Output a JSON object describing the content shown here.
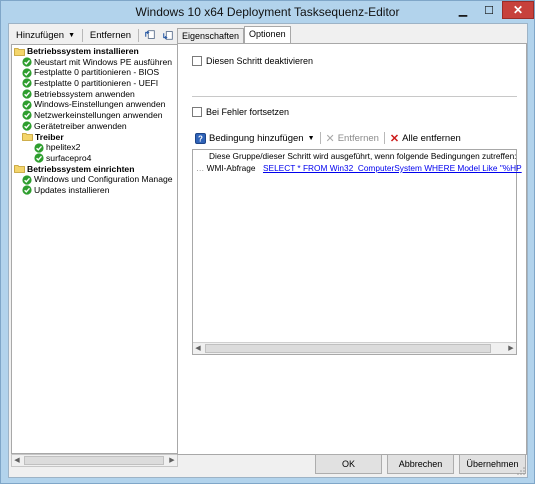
{
  "window": {
    "title": "Windows 10 x64 Deployment Tasksequenz-Editor",
    "minimize_glyph": "▁",
    "maximize_glyph": "☐",
    "close_glyph": "✕"
  },
  "toolbar": {
    "add_label": "Hinzufügen",
    "remove_label": "Entfernen"
  },
  "tree": {
    "items": [
      {
        "label": "Betriebssystem installieren",
        "level": 0,
        "bold": true,
        "icon": "folder-icon"
      },
      {
        "label": "Neustart mit Windows PE ausführen",
        "level": 1,
        "bold": false,
        "icon": "check-icon"
      },
      {
        "label": "Festplatte 0 partitionieren - BIOS",
        "level": 1,
        "bold": false,
        "icon": "check-icon"
      },
      {
        "label": "Festplatte 0 partitionieren - UEFI",
        "level": 1,
        "bold": false,
        "icon": "check-icon"
      },
      {
        "label": "Betriebssystem anwenden",
        "level": 1,
        "bold": false,
        "icon": "check-icon"
      },
      {
        "label": "Windows-Einstellungen anwenden",
        "level": 1,
        "bold": false,
        "icon": "check-icon"
      },
      {
        "label": "Netzwerkeinstellungen anwenden",
        "level": 1,
        "bold": false,
        "icon": "check-icon"
      },
      {
        "label": "Gerätetreiber anwenden",
        "level": 1,
        "bold": false,
        "icon": "check-icon"
      },
      {
        "label": "Treiber",
        "level": 1,
        "bold": true,
        "icon": "folder-icon"
      },
      {
        "label": "hpelitex2",
        "level": 2,
        "bold": false,
        "icon": "check-icon"
      },
      {
        "label": "surfacepro4",
        "level": 2,
        "bold": false,
        "icon": "check-icon"
      },
      {
        "label": "Betriebssystem einrichten",
        "level": 0,
        "bold": true,
        "icon": "folder-icon"
      },
      {
        "label": "Windows und Configuration Manage",
        "level": 1,
        "bold": false,
        "icon": "check-icon"
      },
      {
        "label": "Updates installieren",
        "level": 1,
        "bold": false,
        "icon": "check-icon"
      }
    ]
  },
  "tabs": [
    {
      "label": "Eigenschaften",
      "active": false
    },
    {
      "label": "Optionen",
      "active": true
    }
  ],
  "options": {
    "disable_step_label": "Diesen Schritt deaktivieren",
    "continue_on_error_label": "Bei Fehler fortsetzen",
    "add_condition_label": "Bedingung hinzufügen",
    "remove_label": "Entfernen",
    "remove_all_label": "Alle entfernen",
    "conditions_header": "Diese Gruppe/dieser Schritt wird ausgeführt, wenn folgende Bedingungen zutreffen:",
    "condition_type": "WMI-Abfrage",
    "condition_query": "SELECT * FROM Win32_ComputerSystem WHERE Model Like \"%HP"
  },
  "buttons": {
    "ok": "OK",
    "cancel": "Abbrechen",
    "apply": "Übernehmen"
  },
  "colors": {
    "title_bar": "#b2d3ec",
    "close_button": "#c7413c",
    "check_green": "#2e9e2e",
    "link_blue": "#0000ee"
  }
}
